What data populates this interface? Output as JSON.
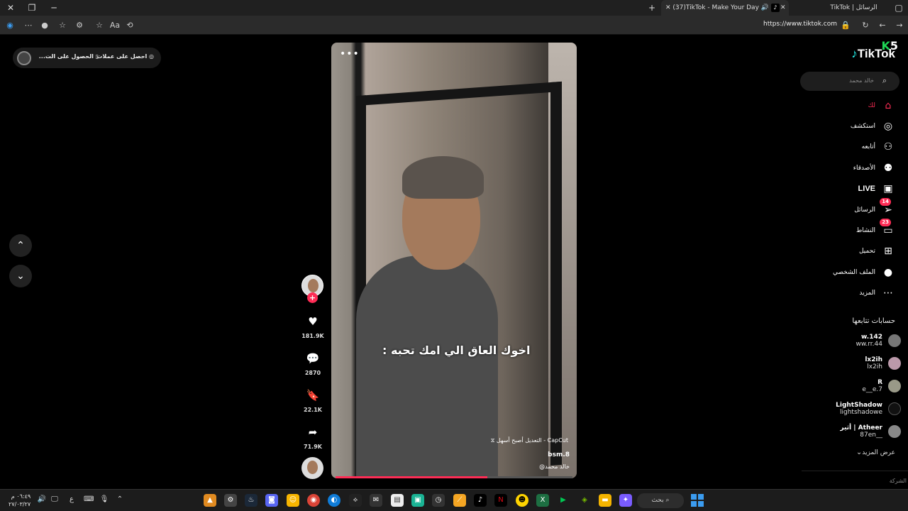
{
  "browser": {
    "active_tab_title": "(37)TikTok - Make Your Day",
    "other_tab_title": "TikTok | الرسائل",
    "url": "https://www.tiktok.com"
  },
  "top_pill": {
    "get_coins": "احصل على عملات",
    "get_app": "الحصول على الت..."
  },
  "sidebar": {
    "logo": "TikTok",
    "k_badge_letter": "K",
    "k_badge_number": "5",
    "search_placeholder": "خالد محمد",
    "nav": [
      {
        "label": "لك",
        "icon": "home-icon"
      },
      {
        "label": "استكشف",
        "icon": "compass-icon"
      },
      {
        "label": "أتابعه",
        "icon": "user-follow-icon"
      },
      {
        "label": "الأصدقاء",
        "icon": "friends-icon"
      },
      {
        "label": "LIVE",
        "icon": "live-icon"
      },
      {
        "label": "الرسائل",
        "icon": "messages-icon",
        "badge": "14"
      },
      {
        "label": "النشاط",
        "icon": "activity-icon",
        "badge": "23"
      },
      {
        "label": "تحميل",
        "icon": "upload-icon"
      },
      {
        "label": "الملف الشخصي",
        "icon": "profile-icon"
      },
      {
        "label": "المزيد",
        "icon": "more-icon"
      }
    ],
    "following_title": "حسابات تتابعها",
    "following": [
      {
        "name": "w.142",
        "user": "ww.rr.44"
      },
      {
        "name": "lx2ih",
        "user": "lx2ih"
      },
      {
        "name": "R",
        "user": "e__e.7"
      },
      {
        "name": "LightShadow",
        "user": "lightshadowe"
      },
      {
        "name": "أثير | Atheer",
        "user": "87en__"
      }
    ],
    "see_more": "عرض المزيد",
    "company": "الشركة"
  },
  "video": {
    "caption": "اخوك العاق الي امك تحبه :",
    "capcut": "CapCut - التعديل أصبح أسهل",
    "username": "bsm.8",
    "handle": "@خالد محمد",
    "progress": 0.64
  },
  "actions": {
    "likes": "181.9K",
    "comments": "2870",
    "saves": "22.1K",
    "shares": "71.9K"
  },
  "taskbar": {
    "time": "٠٦:٤٩ م",
    "date": "٢٧/٠٣/٢٧",
    "search_label": "بحث",
    "lang": "ع"
  }
}
